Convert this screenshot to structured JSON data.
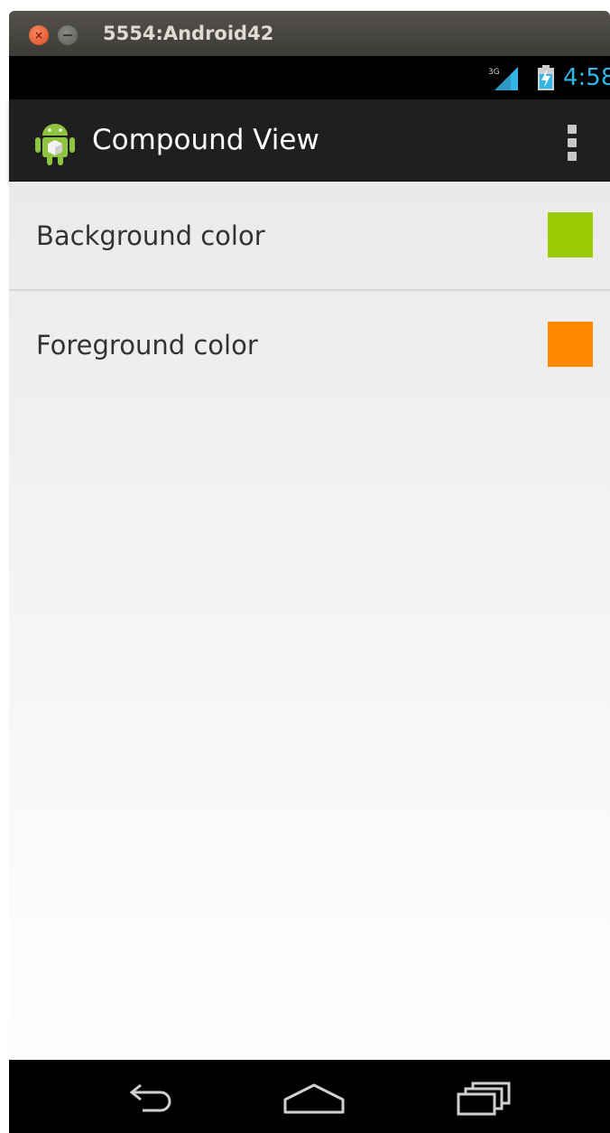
{
  "window": {
    "title": "5554:Android42",
    "close_glyph": "×"
  },
  "status_bar": {
    "network": "3G",
    "time": "4:58",
    "accent": "#33b5e5"
  },
  "action_bar": {
    "title": "Compound View",
    "app_icon": "android-robot-icon",
    "overflow_icon": "overflow-menu-icon"
  },
  "settings": [
    {
      "label": "Background color",
      "color": "#99cc00"
    },
    {
      "label": "Foreground color",
      "color": "#ff8800"
    }
  ],
  "nav_bar": {
    "icons": [
      "back-icon",
      "home-icon",
      "recent-apps-icon"
    ]
  }
}
